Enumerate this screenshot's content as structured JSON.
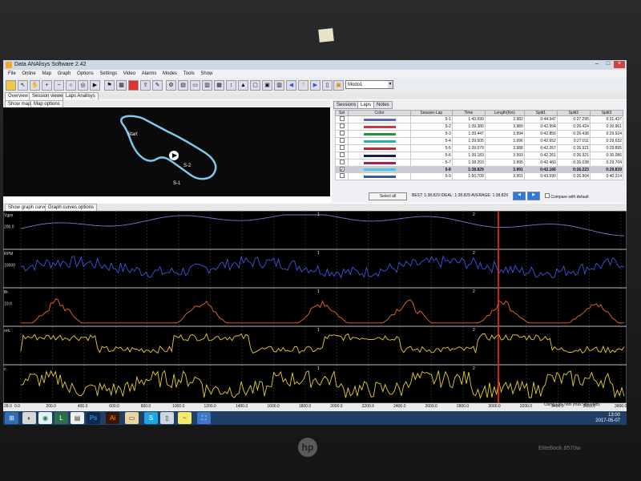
{
  "window": {
    "title": "Data ANAlisys Software 2.42"
  },
  "menu": [
    "File",
    "Online",
    "Map",
    "Graph",
    "Options",
    "Settings",
    "Video",
    "Alarms",
    "Modes",
    "Tools",
    "Show"
  ],
  "toolbar": {
    "mode_select": "Modo1"
  },
  "view_tabs": [
    "Overview",
    "Session viewer",
    "Laps Analisys"
  ],
  "map_tabs": [
    "Show map",
    "Map options"
  ],
  "map": {
    "labels": [
      "Start",
      "S-2",
      "S-1"
    ],
    "track_color": "#7fc8f0"
  },
  "right_tabs": [
    "Sessions",
    "Laps",
    "Notes"
  ],
  "laps_table": {
    "headers": [
      "Sel",
      "Color",
      "Session-Lap",
      "Time",
      "Length(Km)",
      "Split1",
      "Split2",
      "Split3"
    ],
    "rows": [
      {
        "sel": false,
        "color": "#5b67b9",
        "lap": "5-1",
        "time": "1:43.099",
        "len": "3.982",
        "s1": "0:44.347",
        "s2": "0:27.295",
        "s3": "0:31.437"
      },
      {
        "sel": false,
        "color": "#cf3640",
        "lap": "5-2",
        "time": "1:39.380",
        "len": "3.989",
        "s1": "0:42.994",
        "s2": "0:26.424",
        "s3": "0:30.961"
      },
      {
        "sel": false,
        "color": "#2f8f3a",
        "lap": "5-3",
        "time": "1:39.447",
        "len": "3.994",
        "s1": "0:42.856",
        "s2": "0:26.438",
        "s3": "0:29.924"
      },
      {
        "sel": false,
        "color": "#2cb0ad",
        "lap": "5-4",
        "time": "1:39.505",
        "len": "3.996",
        "s1": "0:42.652",
        "s2": "0:27.011",
        "s3": "0:29.632"
      },
      {
        "sel": false,
        "color": "#b0303a",
        "lap": "5-5",
        "time": "1:39.079",
        "len": "3.988",
        "s1": "0:42.267",
        "s2": "0:26.921",
        "s3": "0:29.895"
      },
      {
        "sel": false,
        "color": "#151b63",
        "lap": "5-6",
        "time": "1:39.183",
        "len": "3.993",
        "s1": "0:42.261",
        "s2": "0:26.921",
        "s3": "0:30.086"
      },
      {
        "sel": false,
        "color": "#a1205e",
        "lap": "5-7",
        "time": "1:38.203",
        "len": "3.995",
        "s1": "0:42.460",
        "s2": "0:26.038",
        "s3": "0:29.704"
      },
      {
        "sel": true,
        "color": "#4ec6de",
        "lap": "5-8",
        "time": "1:38.829",
        "len": "3.991",
        "s1": "0:42.166",
        "s2": "0:26.223",
        "s3": "0:29.839"
      },
      {
        "sel": false,
        "color": "#3a55a8",
        "lap": "5-9",
        "time": "1:50.709",
        "len": "3.951",
        "s1": "0:43.590",
        "s2": "0:26.904",
        "s3": "0:40.214"
      }
    ],
    "select_all": "Select all",
    "summary": "BEST: 1:38.829 IDEAL: 1:38.829 AVERAGE: 1:38.829",
    "compare_label": "Compare with default"
  },
  "graph_tabs": [
    "Show graph curves",
    "Graph curves options"
  ],
  "graph": {
    "channels": [
      {
        "label": "Vgps",
        "tick": "200.0",
        "color": "#8a6fd6"
      },
      {
        "label": "RPM",
        "tick": "10000",
        "color": "#3f54e0"
      },
      {
        "label": "Br.",
        "tick": "10.0",
        "color": "#ef6a20"
      },
      {
        "label": "ork.",
        "tick": "",
        "color": "#e7d02a"
      },
      {
        "label": "c.",
        "tick": "",
        "color": "#e7d02a"
      }
    ],
    "cursor_color": "#ff2a14",
    "markers": [
      "1",
      "2"
    ],
    "x_ticks": [
      "0.0",
      "200.0",
      "400.0",
      "600.0",
      "800.0",
      "1000.0",
      "1200.0",
      "1400.0",
      "1600.0",
      "1800.0",
      "2000.0",
      "2200.0",
      "2400.0",
      "2600.0",
      "2800.0",
      "3000.0",
      "3200.0",
      "3400.0",
      "3600.0",
      "3800.0"
    ],
    "x_left_label": "28.0"
  },
  "status": {
    "memory": "Using 139.7MB (max 989.9MB)"
  },
  "taskbar": {
    "time": "13:00",
    "date": "2017-05-07"
  },
  "laptop": {
    "brand": "hp",
    "model": "EliteBook 8570w"
  }
}
